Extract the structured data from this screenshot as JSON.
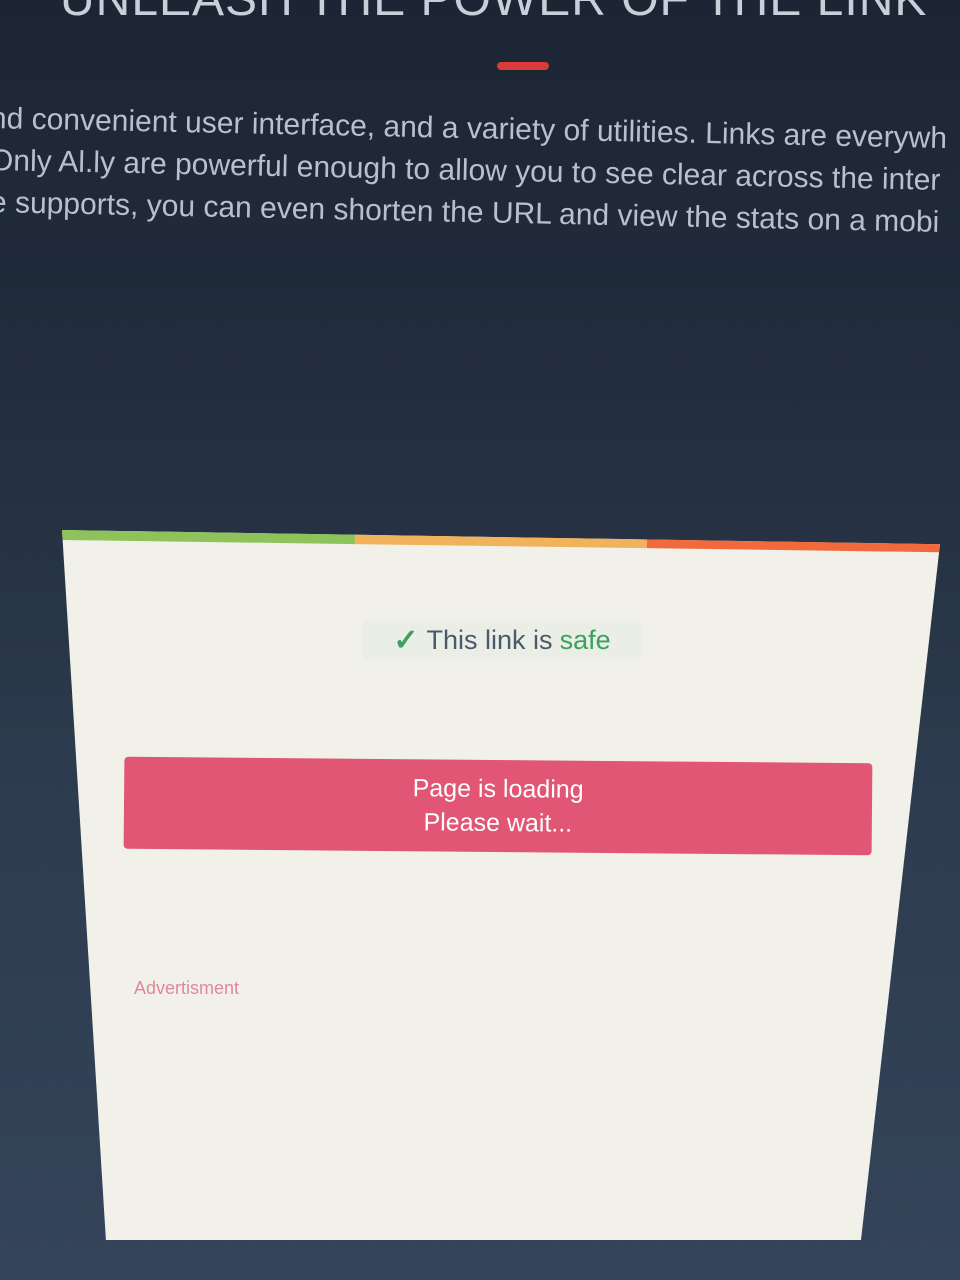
{
  "hero": {
    "title": "UNLEASH THE POWER OF THE LINK",
    "lines": [
      "nd convenient user interface, and a variety of utilities. Links are everywh",
      "Only Al.ly are powerful enough to allow you to see clear across the inter",
      "e supports, you can even shorten the URL and view the stats on a mobi"
    ]
  },
  "modal": {
    "stripe_colors": [
      "#8dc35a",
      "#f0b25a",
      "#f26a3c"
    ],
    "status_prefix": "This link is",
    "status_word": "safe",
    "loading_line1": "Page is loading",
    "loading_line2": "Please wait...",
    "ad_label": "Advertisment"
  },
  "icons": {
    "check": "check-icon"
  },
  "colors": {
    "accent": "#e05674",
    "safe": "#3aa25a"
  }
}
